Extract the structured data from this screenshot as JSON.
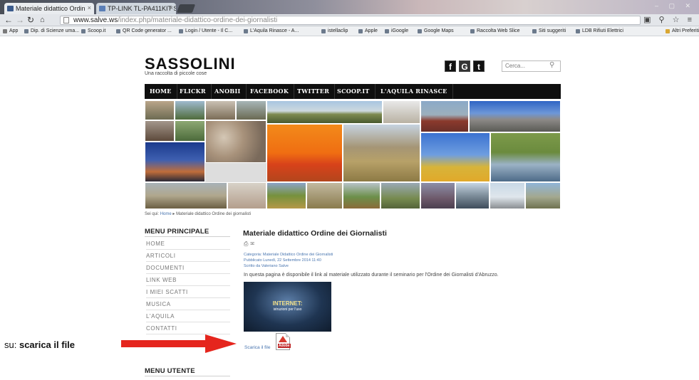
{
  "browser": {
    "tabs": [
      {
        "title": "Materiale didattico Ordin"
      },
      {
        "title": "TP-LINK TL-PA411KIT Sta"
      }
    ],
    "url_host": "www.salve.ws",
    "url_path": "/index.php/materiale-didattico-ordine-dei-giornalisti",
    "bookmarks": [
      "App",
      "Dip. di Scienze uma...",
      "Scoop.it",
      "QR Code generator ...",
      "Login / Utente - Il C...",
      "L'Aquila Rinasce - A...",
      "istellaclip",
      "Apple",
      "iGoogle",
      "Google Maps",
      "Raccolta Web Slice",
      "Siti suggeriti",
      "LDB Rifiuti Elettrici",
      "Altri Preferiti"
    ]
  },
  "site": {
    "logo": "SASSOLINI",
    "tagline": "Una raccolta di piccole cose",
    "social": [
      "f",
      "G",
      "t"
    ],
    "search_placeholder": "Cerca...",
    "nav": [
      "HOME",
      "FLICKR",
      "ANOBII",
      "FACEBOOK",
      "TWITTER",
      "SCOOP.IT",
      "L'AQUILA RINASCE"
    ]
  },
  "breadcrumb": {
    "prefix": "Sei qui:",
    "home": "Home",
    "current": "Materiale didattico Ordine dei giornalisti"
  },
  "sidebar": {
    "main_title": "MENU PRINCIPALE",
    "items": [
      "HOME",
      "ARTICOLI",
      "DOCUMENTI",
      "LINK WEB",
      "I MIEI SCATTI",
      "MUSICA",
      "L'AQUILA",
      "CONTATTI"
    ],
    "user_title": "MENU UTENTE"
  },
  "article": {
    "title": "Materiale didattico Ordine dei Giornalisti",
    "category_label": "Categoria:",
    "category": "Materiale Didattico Ordine dei Giornalisti",
    "published": "Pubblicato Lunedì, 22 Settembre 2014 11:40",
    "author": "Scritto da Valeriano Salve",
    "intro": "In questa pagina è disponibile il link al materiale utilizzato durante il seminario per l'Ordine dei Giornalisti d'Abruzzo.",
    "thumb_title": "INTERNET:",
    "thumb_subtitle": "istruzioni per l'uso",
    "download_label": "Scarica il file",
    "pdf_label": "Adobe"
  },
  "annotation": {
    "prefix": "su: ",
    "bold": "scarica il file"
  },
  "colors": {
    "nav_bg": "#0f0f0f",
    "link": "#4a76b0",
    "arrow": "#e5251d"
  }
}
